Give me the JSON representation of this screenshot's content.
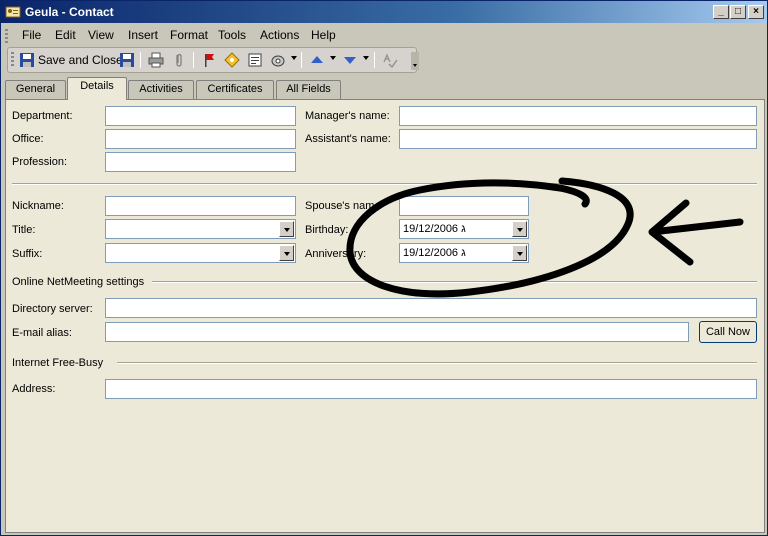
{
  "window": {
    "title": "Geula - Contact"
  },
  "menu": [
    "File",
    "Edit",
    "View",
    "Insert",
    "Format",
    "Tools",
    "Actions",
    "Help"
  ],
  "toolbar": {
    "save_close_label": "Save and Close"
  },
  "tabs": [
    "General",
    "Details",
    "Activities",
    "Certificates",
    "All Fields"
  ],
  "form": {
    "department_label": "Department:",
    "office_label": "Office:",
    "profession_label": "Profession:",
    "managers_name_label": "Manager's name:",
    "assistants_name_label": "Assistant's name:",
    "nickname_label": "Nickname:",
    "title_label": "Title:",
    "suffix_label": "Suffix:",
    "spouses_name_label": "Spouse's name",
    "birthday_label": "Birthday:",
    "anniversary_label": "Anniversary:",
    "birthday_value": "19/12/2006 ג",
    "anniversary_value": "19/12/2006 ג",
    "netmeeting_heading": "Online NetMeeting settings",
    "directory_server_label": "Directory server:",
    "email_alias_label": "E-mail alias:",
    "call_now_label": "Call Now",
    "freebusy_heading": "Internet Free-Busy",
    "address_label": "Address:"
  },
  "colors": {
    "titlebar": "#0A246A",
    "panel": "#ECE9D8",
    "annotation": "#000000"
  }
}
